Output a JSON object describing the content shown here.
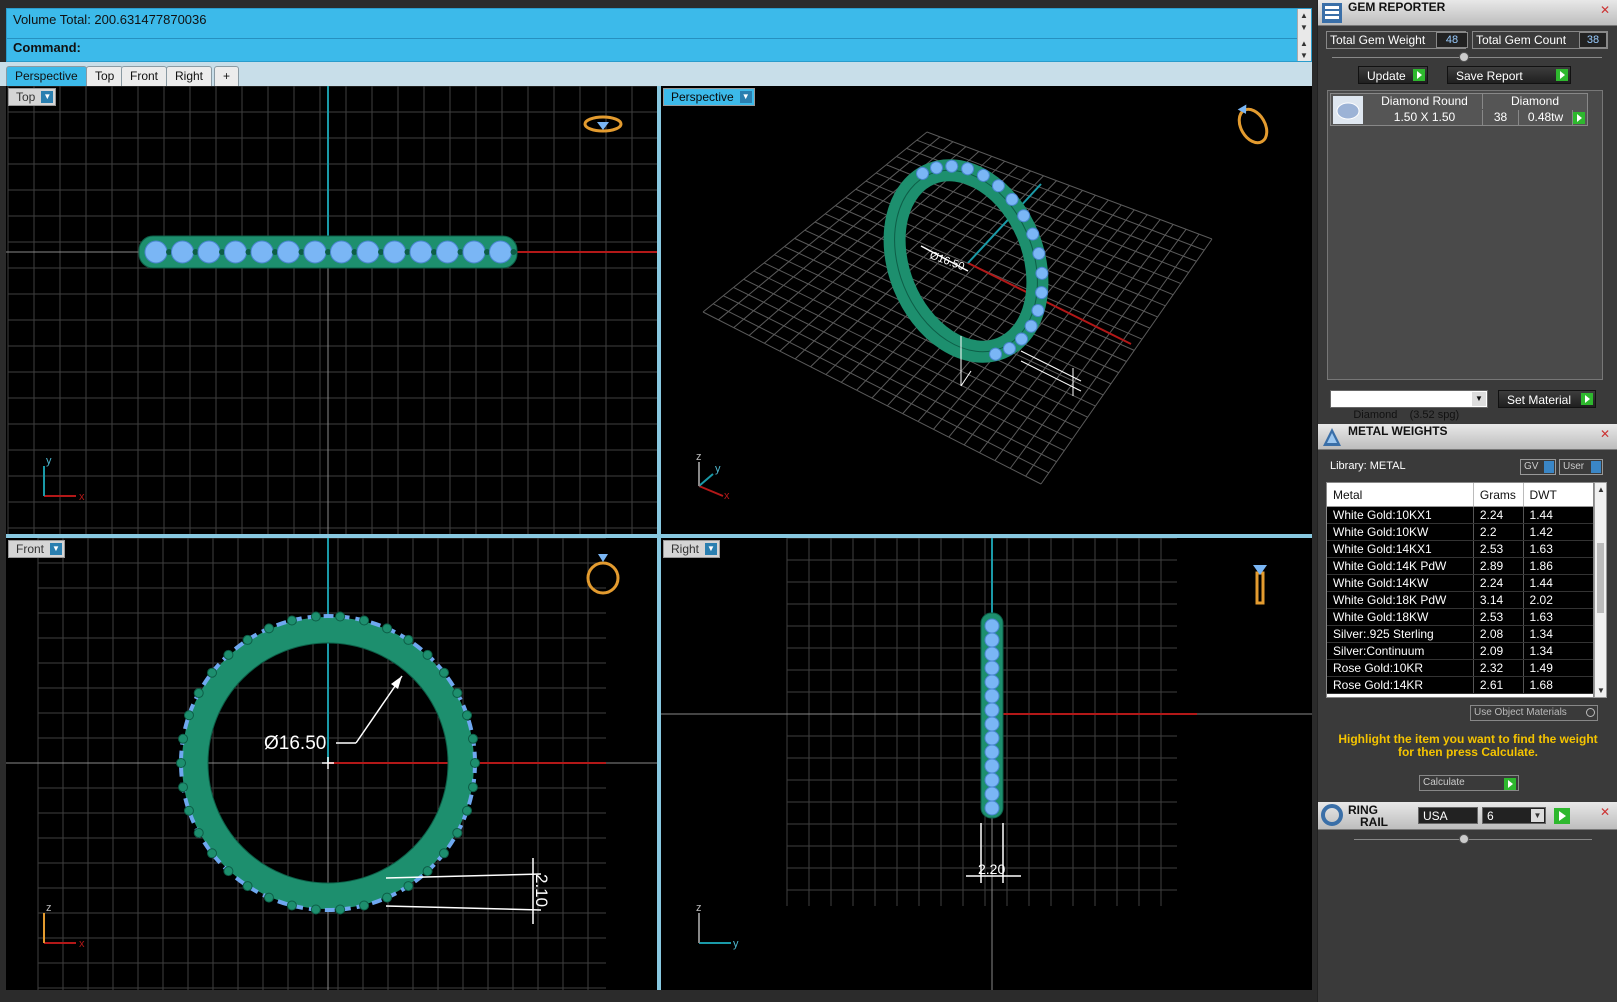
{
  "command": {
    "history": "Volume Total: 200.631477870036",
    "prompt": "Command:"
  },
  "tabs": [
    "Perspective",
    "Top",
    "Front",
    "Right",
    "+"
  ],
  "viewports": {
    "top": {
      "label": "Top"
    },
    "perspective": {
      "label": "Perspective",
      "dimension": "Ø16.50"
    },
    "front": {
      "label": "Front",
      "dimension": "Ø16.50",
      "width": "2.10"
    },
    "right": {
      "label": "Right",
      "width": "2.20"
    }
  },
  "gem_reporter": {
    "title": "GEM REPORTER",
    "total_weight_label": "Total Gem Weight",
    "total_weight_value": "48",
    "total_count_label": "Total Gem Count",
    "total_count_value": "38",
    "update_label": "Update",
    "save_report_label": "Save Report",
    "gem": {
      "name": "Diamond Round",
      "material": "Diamond",
      "size": "1.50 X 1.50",
      "count": "38",
      "weight": "0.48tw"
    },
    "material_select": "Diamond    (3.52 spg)",
    "set_material_label": "Set Material"
  },
  "metal_weights": {
    "title": "METAL WEIGHTS",
    "library_label": "Library: METAL",
    "gv_label": "GV",
    "user_label": "User",
    "headers": [
      "Metal",
      "Grams",
      "DWT"
    ],
    "rows": [
      [
        "White Gold:10KX1",
        "2.24",
        "1.44"
      ],
      [
        "White Gold:10KW",
        "2.2",
        "1.42"
      ],
      [
        "White Gold:14KX1",
        "2.53",
        "1.63"
      ],
      [
        "White Gold:14K PdW",
        "2.89",
        "1.86"
      ],
      [
        "White Gold:14KW",
        "2.24",
        "1.44"
      ],
      [
        "White Gold:18K PdW",
        "3.14",
        "2.02"
      ],
      [
        "White Gold:18KW",
        "2.53",
        "1.63"
      ],
      [
        "Silver:.925 Sterling",
        "2.08",
        "1.34"
      ],
      [
        "Silver:Continuum",
        "2.09",
        "1.34"
      ],
      [
        "Rose Gold:10KR",
        "2.32",
        "1.49"
      ],
      [
        "Rose Gold:14KR",
        "2.61",
        "1.68"
      ]
    ],
    "use_object_materials": "Use Object Materials",
    "hint": "Highlight the item you want to find the weight for then press Calculate.",
    "calculate_label": "Calculate"
  },
  "ring_rail": {
    "title_line1": "RING",
    "title_line2": "RAIL",
    "country": "USA",
    "size": "6"
  },
  "colors": {
    "accent": "#3cbaea",
    "ring_metal": "#1d8f6e",
    "gem": "#7ab6f5",
    "hint_text": "#f5c400"
  }
}
